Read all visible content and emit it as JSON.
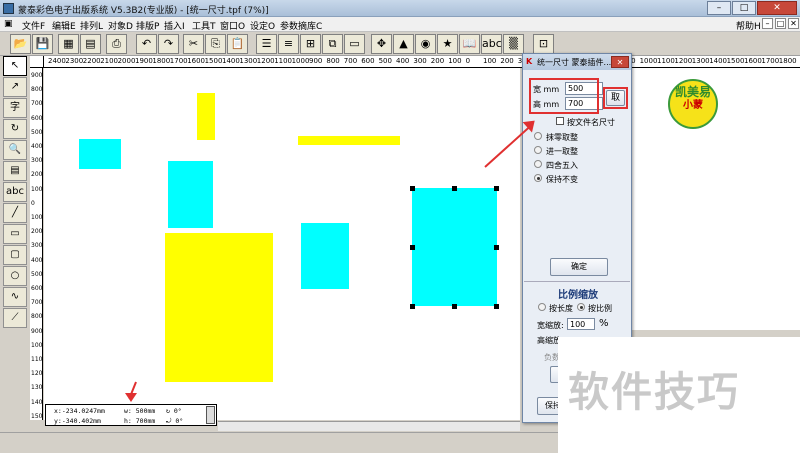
{
  "window": {
    "title": "蒙泰彩色电子出版系统 V5.3B2(专业版) - [统一尺寸.tpf (7%)]",
    "controls": [
      "–",
      "□",
      "✕"
    ]
  },
  "menu": {
    "items": [
      "文件F",
      "编辑E",
      "排列L",
      "对象D",
      "排版P",
      "插入I",
      "工具T",
      "窗口O",
      "设定O",
      "参数摘库C"
    ],
    "right_items": [
      "帮助H"
    ],
    "mdi_controls": [
      "–",
      "□",
      "✕"
    ]
  },
  "toolbar": {
    "buttons": [
      "new-icon",
      "save-icon",
      "image-icon",
      "copy-doc-icon",
      "print-icon",
      "undo-icon",
      "redo-icon",
      "cut-icon",
      "copy-icon",
      "paste-icon",
      "align-icon",
      "text-frame-icon",
      "table-icon",
      "frames-icon",
      "move-icon",
      "shapes-icon",
      "color-icon",
      "star-icon",
      "book-icon",
      "abc-icon",
      "zoom-page-icon"
    ]
  },
  "left_tools": {
    "items": [
      "arrow-icon",
      "pointer-icon",
      "text-icon",
      "rotate-icon",
      "zoom-icon",
      "page-icon",
      "abc-icon",
      "line-icon",
      "rect-icon",
      "round-rect-icon",
      "ellipse-icon",
      "curve-icon",
      "polyline-icon",
      "dotted-icon"
    ],
    "labels": [
      "↖",
      "↗",
      "字",
      "↻",
      "🔍",
      "▤",
      "abc",
      "╱",
      "▭",
      "▢",
      "○",
      "∿",
      "⟋",
      "⋯"
    ]
  },
  "ruler_top": [
    "2400",
    "2300",
    "2200",
    "2100",
    "2000",
    "1900",
    "1800",
    "1700",
    "1600",
    "1500",
    "1400",
    "1300",
    "1200",
    "1100",
    "1000",
    "900",
    "800",
    "700",
    "600",
    "500",
    "400",
    "300",
    "200",
    "100",
    "0",
    "100",
    "200",
    "300",
    "400",
    "500",
    "600",
    "700",
    "800",
    "900",
    "1000",
    "1100",
    "1200",
    "1300",
    "1400",
    "1500",
    "1600",
    "1700",
    "1800"
  ],
  "ruler_left": [
    "900",
    "800",
    "700",
    "600",
    "500",
    "400",
    "300",
    "200",
    "100",
    "0",
    "100",
    "200",
    "300",
    "400",
    "500",
    "600",
    "700",
    "800",
    "900",
    "1000",
    "1100",
    "1200",
    "1300",
    "1400",
    "1500"
  ],
  "dialog": {
    "title": "统一尺寸 蒙泰插件...",
    "close": "✕",
    "width_label": "宽 mm",
    "width_value": "500",
    "height_label": "高 mm",
    "height_value": "700",
    "fetch_button": "取",
    "file_size_checkbox": "按文件名尺寸",
    "rounding_options": [
      "抹零取整",
      "进一取整",
      "四舍五入",
      "保持不变"
    ],
    "rounding_selected": 3,
    "confirm_button": "确定",
    "scale_section_title": "比例缩放",
    "scale_modes": [
      "按长度",
      "按比例"
    ],
    "scale_mode_selected": 1,
    "width_scale_label": "宽缩放:",
    "width_scale_value": "100",
    "width_scale_unit": "%",
    "height_scale_label": "高缩放",
    "negative_label": "负数",
    "keep_button": "保持"
  },
  "status_panel": {
    "x": "x:-234.0247mm",
    "w": "w: 500mm",
    "rot": "↻ 0°",
    "y": "y:-340.402mm",
    "h": "h: 700mm",
    "skew": "⤾ 0°"
  },
  "logo": {
    "line1": "凯美易",
    "line2": "小蒙"
  },
  "watermark": "软件技巧",
  "colors": {
    "cyan": "#00ffff",
    "yellow": "#ffff00",
    "highlight": "#e03030"
  }
}
